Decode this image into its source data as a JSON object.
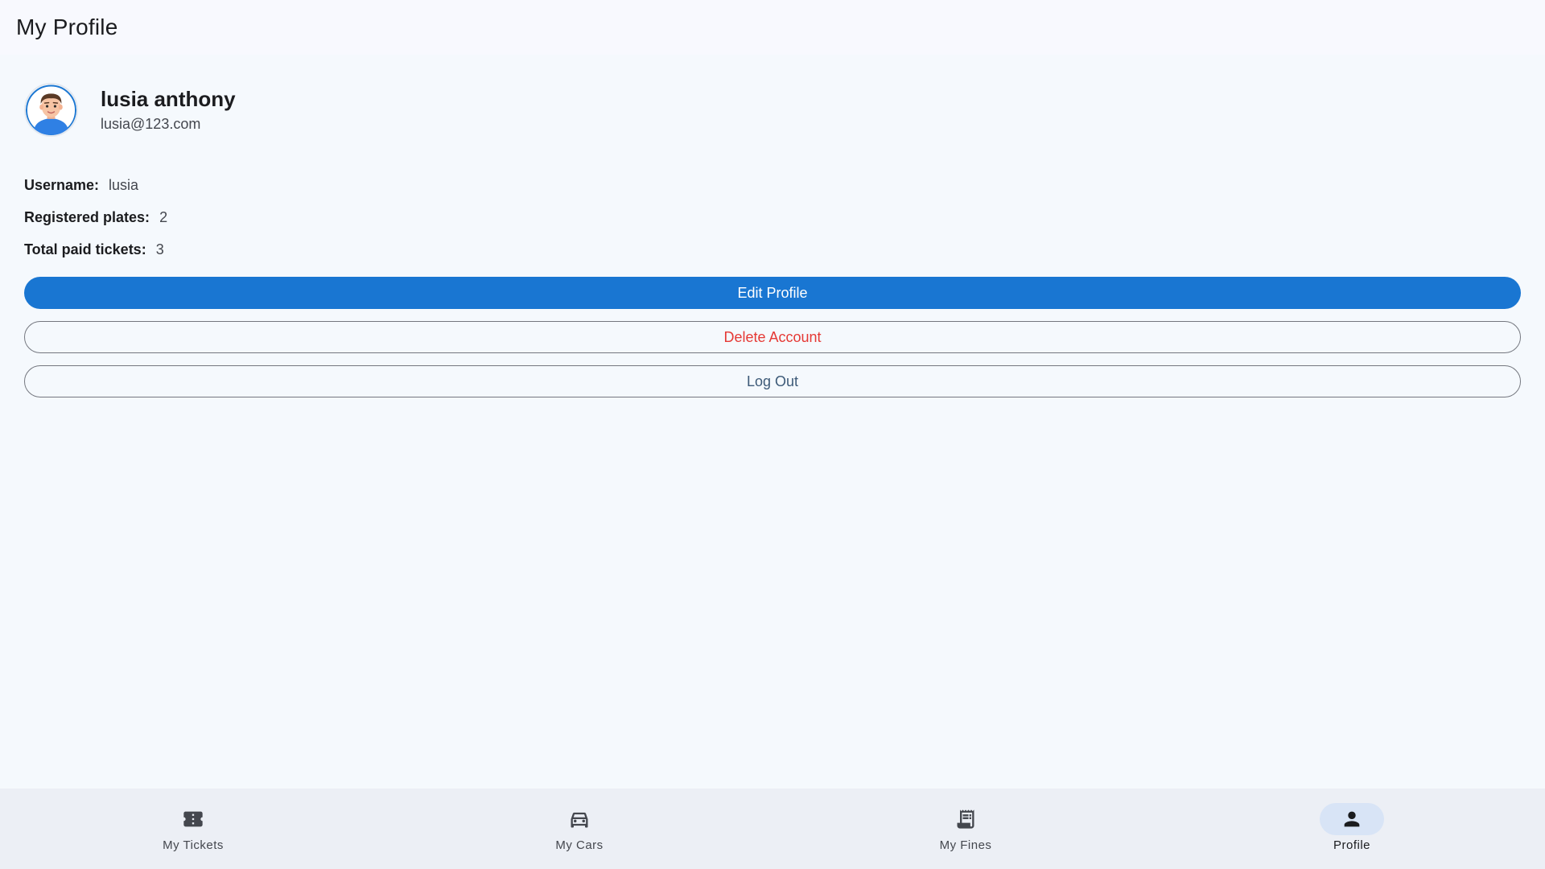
{
  "app_bar": {
    "title": "My Profile"
  },
  "profile": {
    "name": "lusia anthony",
    "email": "lusia@123.com",
    "avatar_icon": "user-avatar-icon"
  },
  "info": [
    {
      "label": "Username:",
      "value": "lusia"
    },
    {
      "label": "Registered plates:",
      "value": "2"
    },
    {
      "label": "Total paid tickets:",
      "value": "3"
    }
  ],
  "actions": {
    "edit_label": "Edit Profile",
    "delete_label": "Delete Account",
    "logout_label": "Log Out"
  },
  "bottom_nav": {
    "items": [
      {
        "label": "My Tickets",
        "icon": "ticket-icon",
        "active": false
      },
      {
        "label": "My Cars",
        "icon": "car-icon",
        "active": false
      },
      {
        "label": "My Fines",
        "icon": "receipt-icon",
        "active": false
      },
      {
        "label": "Profile",
        "icon": "person-icon",
        "active": true
      }
    ]
  },
  "colors": {
    "primary": "#1976d2",
    "danger": "#e53935",
    "background": "#f5f9fd",
    "nav_background": "#eceff5",
    "nav_active_indicator": "#d8e4f6"
  }
}
